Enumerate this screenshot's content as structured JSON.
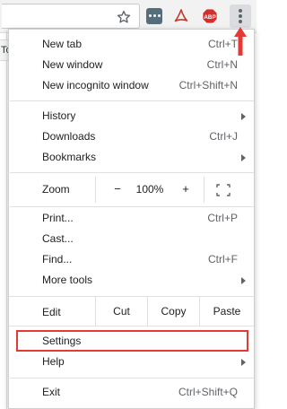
{
  "toolbar": {
    "bookmark_icon": "star-icon",
    "extensions": [
      "more-horizontal-extension-icon",
      "acrobat-icon",
      "adblock-plus-icon"
    ],
    "abp_text": "ABP",
    "menu_button_icon": "vertical-dots-icon"
  },
  "background_page": {
    "tab_text": "To"
  },
  "colors": {
    "highlight": "#e53935",
    "abp": "#d32f2f",
    "acrobat": "#b71c1c"
  },
  "menu": {
    "new_tab": {
      "label": "New tab",
      "shortcut": "Ctrl+T"
    },
    "new_window": {
      "label": "New window",
      "shortcut": "Ctrl+N"
    },
    "new_incognito": {
      "label": "New incognito window",
      "shortcut": "Ctrl+Shift+N"
    },
    "history": {
      "label": "History"
    },
    "downloads": {
      "label": "Downloads",
      "shortcut": "Ctrl+J"
    },
    "bookmarks": {
      "label": "Bookmarks"
    },
    "zoom": {
      "label": "Zoom",
      "minus": "−",
      "value": "100%",
      "plus": "+"
    },
    "print": {
      "label": "Print...",
      "shortcut": "Ctrl+P"
    },
    "cast": {
      "label": "Cast..."
    },
    "find": {
      "label": "Find...",
      "shortcut": "Ctrl+F"
    },
    "more_tools": {
      "label": "More tools"
    },
    "edit": {
      "label": "Edit",
      "cut": "Cut",
      "copy": "Copy",
      "paste": "Paste"
    },
    "settings": {
      "label": "Settings"
    },
    "help": {
      "label": "Help"
    },
    "exit": {
      "label": "Exit",
      "shortcut": "Ctrl+Shift+Q"
    }
  }
}
